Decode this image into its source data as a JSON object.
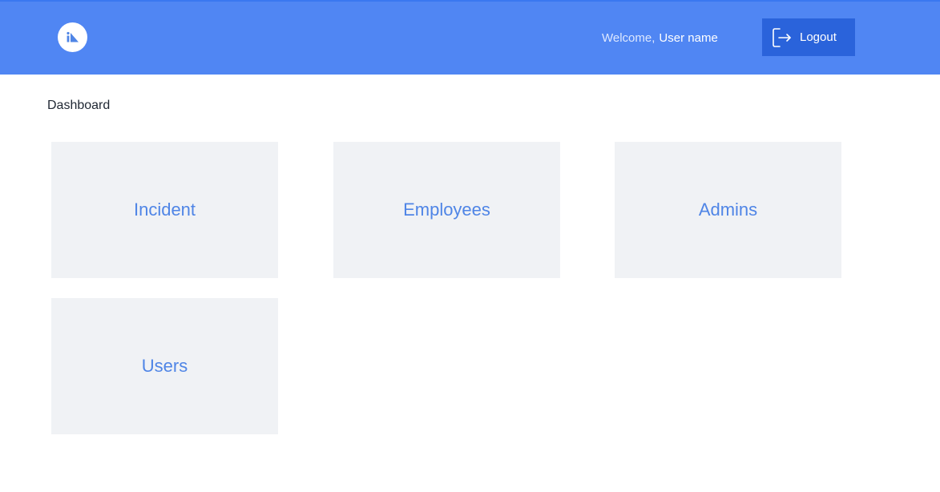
{
  "header": {
    "logo_icon": "brand-logo-icon",
    "welcome_label": "Welcome,",
    "user_name": "User name",
    "logout_label": "Logout",
    "logout_icon": "logout-icon",
    "background_color": "#5086f3",
    "button_color": "#2a63db"
  },
  "main": {
    "title": "Dashboard",
    "cards": [
      {
        "label": "Incident"
      },
      {
        "label": "Employees"
      },
      {
        "label": "Admins"
      },
      {
        "label": "Users"
      }
    ],
    "card_background": "#f0f2f5",
    "card_text_color": "#4f85e6"
  }
}
